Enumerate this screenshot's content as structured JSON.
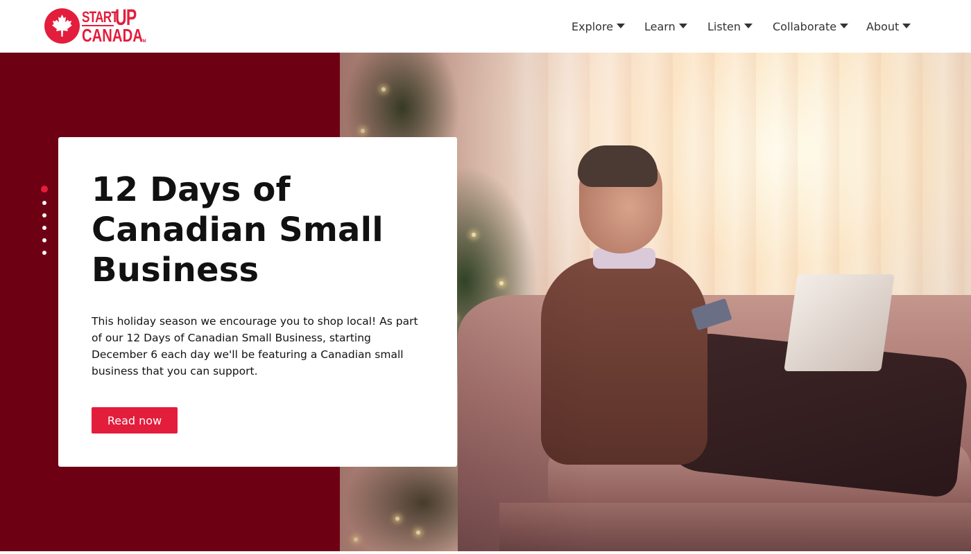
{
  "brand": {
    "logo_start": "START",
    "logo_up": "UP",
    "logo_canada": "CANADA",
    "logo_tm": "TM",
    "accent_color": "#e31d3c",
    "hero_bg_color": "#6e0014"
  },
  "nav": {
    "items": [
      {
        "label": "Explore",
        "icon": "caret-down-icon"
      },
      {
        "label": "Learn",
        "icon": "caret-down-icon"
      },
      {
        "label": "Listen",
        "icon": "caret-down-icon"
      },
      {
        "label": "Collaborate",
        "icon": "caret-down-icon"
      },
      {
        "label": "About",
        "icon": "caret-down-icon"
      }
    ]
  },
  "hero": {
    "title": "12 Days of Canadian Small Business",
    "description": "This holiday season we encourage you to shop local! As part of our 12 Days of Canadian Small Business, starting December 6 each day we'll be featuring a Canadian small business that you can support.",
    "cta_label": "Read now",
    "slides_total": 6,
    "active_slide": 1
  }
}
